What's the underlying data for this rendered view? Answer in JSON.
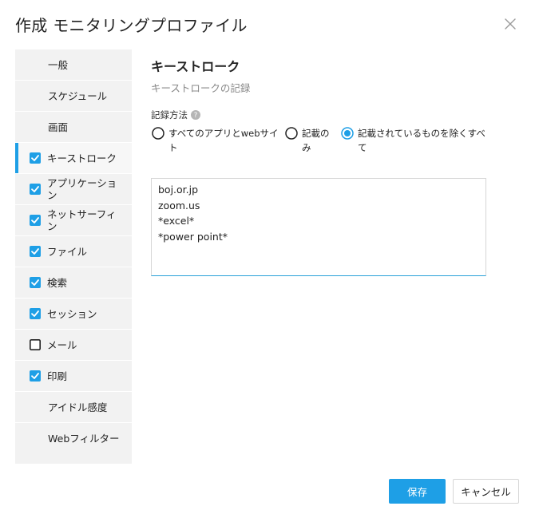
{
  "dialog": {
    "title": "作成 モニタリングプロファイル"
  },
  "sidebar": {
    "items": [
      {
        "label": "一般",
        "checkbox": null
      },
      {
        "label": "スケジュール",
        "checkbox": null
      },
      {
        "label": "画面",
        "checkbox": null
      },
      {
        "label": "キーストローク",
        "checkbox": true,
        "active": true
      },
      {
        "label": "アプリケーション",
        "checkbox": true
      },
      {
        "label": "ネットサーフィン",
        "checkbox": true
      },
      {
        "label": "ファイル",
        "checkbox": true
      },
      {
        "label": "検索",
        "checkbox": true
      },
      {
        "label": "セッション",
        "checkbox": true
      },
      {
        "label": "メール",
        "checkbox": false
      },
      {
        "label": "印刷",
        "checkbox": true
      },
      {
        "label": "アイドル感度",
        "checkbox": null
      },
      {
        "label": "Webフィルター",
        "checkbox": null
      }
    ]
  },
  "main": {
    "title": "キーストローク",
    "subtitle": "キーストロークの記録",
    "method_label": "記録方法",
    "radio_options": [
      {
        "label": "すべてのアプリとwebサイト",
        "selected": false
      },
      {
        "label": "記載のみ",
        "selected": false
      },
      {
        "label": "記載されているものを除くすべて",
        "selected": true
      }
    ],
    "keywords": "boj.or.jp\nzoom.us\n*excel*\n*power point*"
  },
  "footer": {
    "save_label": "保存",
    "cancel_label": "キャンセル"
  },
  "colors": {
    "accent": "#1e9fe6",
    "sidebar_bg": "#f2f2f2"
  },
  "icons": {
    "close": "close-icon",
    "checkbox_checked": "checkbox-checked-icon",
    "checkbox_unchecked": "checkbox-unchecked-icon",
    "help": "help-icon"
  }
}
